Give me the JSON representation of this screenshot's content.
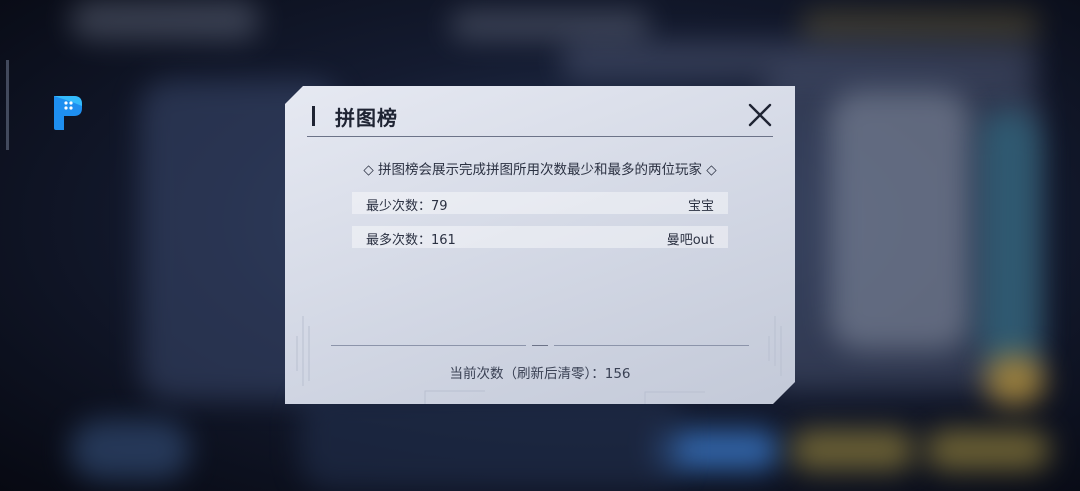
{
  "dialog": {
    "title": "拼图榜",
    "description": "◇ 拼图榜会展示完成拼图所用次数最少和最多的两位玩家 ◇",
    "rows": [
      {
        "label": "最少次数：79",
        "player": "宝宝"
      },
      {
        "label": "最多次数：161",
        "player": "曼吧out"
      }
    ],
    "current": "当前次数（刷新后清零）：156",
    "close_icon": "close-icon"
  },
  "floating_app_icon": "app-shortcut-icon",
  "colors": {
    "dialog_bg": "#dde1ec",
    "text_dark": "#1f2433",
    "app_icon_blue": "#1e90ff"
  }
}
